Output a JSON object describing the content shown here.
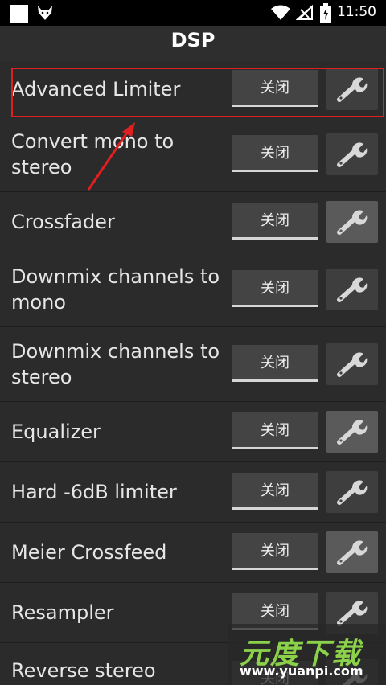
{
  "statusbar": {
    "time": "11:50"
  },
  "header": {
    "title": "DSP"
  },
  "items": [
    {
      "label": "Advanced Limiter",
      "toggle": "关闭"
    },
    {
      "label": "Convert mono to stereo",
      "toggle": "关闭"
    },
    {
      "label": "Crossfader",
      "toggle": "关闭"
    },
    {
      "label": "Downmix channels to mono",
      "toggle": "关闭"
    },
    {
      "label": "Downmix channels to stereo",
      "toggle": "关闭"
    },
    {
      "label": "Equalizer",
      "toggle": "关闭"
    },
    {
      "label": "Hard -6dB limiter",
      "toggle": "关闭"
    },
    {
      "label": "Meier Crossfeed",
      "toggle": "关闭"
    },
    {
      "label": "Resampler",
      "toggle": "关闭"
    },
    {
      "label": "Reverse stereo",
      "toggle": "关闭"
    }
  ],
  "watermark": {
    "title": "元度下载",
    "url": "www.yuanpi.com"
  },
  "colors": {
    "highlight": "#e02020",
    "watermark_accent": "#8bd14a"
  }
}
